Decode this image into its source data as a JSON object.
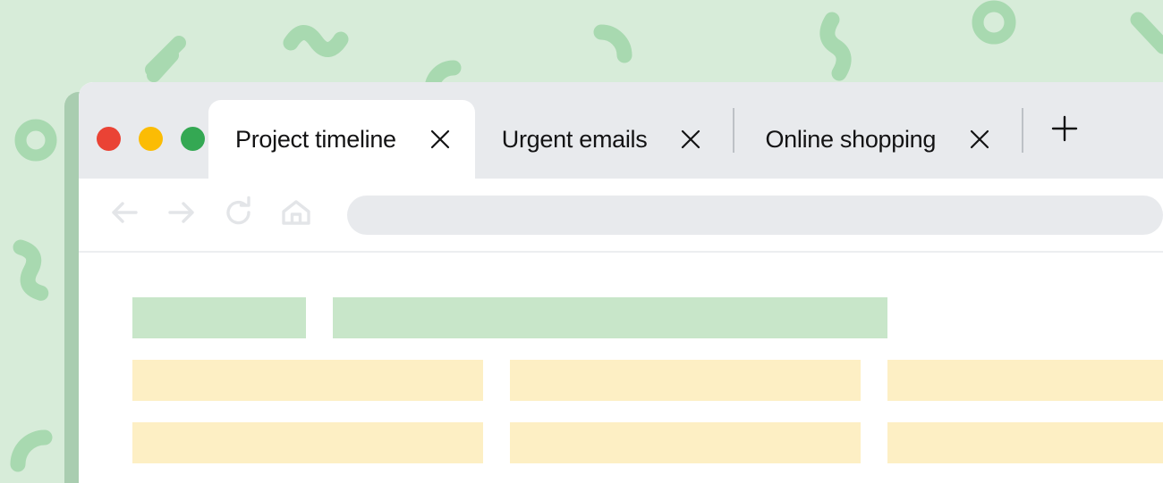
{
  "theme": {
    "backdrop_color": "#d7ecd9",
    "confetti_color": "#a8d9b0",
    "window_shadow_color": "#a9cdb0",
    "tab_strip_color": "#e8eaed",
    "active_tab_color": "#ffffff",
    "toolbar_color": "#ffffff",
    "address_bar_color": "#e8eaed",
    "icon_color": "#e3e5e8",
    "separator_color": "#bdc1c6",
    "block_green": "#c8e6c9",
    "block_yellow": "#fdefc4"
  },
  "window": {
    "traffic_lights": [
      {
        "name": "close-window-button",
        "label": "Close",
        "color": "#ea4335"
      },
      {
        "name": "minimize-window-button",
        "label": "Minimize",
        "color": "#fbbc04"
      },
      {
        "name": "maximize-window-button",
        "label": "Maximize",
        "color": "#34a853"
      }
    ]
  },
  "tabs": [
    {
      "label": "Project timeline",
      "active": true,
      "close_icon": "close-icon"
    },
    {
      "label": "Urgent emails",
      "active": false,
      "close_icon": "close-icon"
    },
    {
      "label": "Online shopping",
      "active": false,
      "close_icon": "close-icon"
    }
  ],
  "new_tab": {
    "label": "+",
    "icon": "plus-icon"
  },
  "toolbar": {
    "buttons": [
      {
        "name": "back-button",
        "icon": "arrow-left-icon",
        "label": "Back"
      },
      {
        "name": "forward-button",
        "icon": "arrow-right-icon",
        "label": "Forward"
      },
      {
        "name": "reload-button",
        "icon": "reload-icon",
        "label": "Reload"
      },
      {
        "name": "home-button",
        "icon": "home-icon",
        "label": "Home"
      }
    ],
    "address_bar": {
      "value": "",
      "placeholder": ""
    }
  },
  "page_content": {
    "rows": [
      {
        "name": "header-row",
        "blocks": [
          {
            "color": "green",
            "width": "w-sm"
          },
          {
            "color": "green",
            "width": "w-lg"
          }
        ]
      },
      {
        "name": "content-row-1",
        "blocks": [
          {
            "color": "yellow",
            "width": "w-md"
          },
          {
            "color": "yellow",
            "width": "w-md"
          },
          {
            "color": "yellow",
            "width": "w-md"
          }
        ]
      },
      {
        "name": "content-row-2",
        "blocks": [
          {
            "color": "yellow",
            "width": "w-md"
          },
          {
            "color": "yellow",
            "width": "w-md"
          },
          {
            "color": "yellow",
            "width": "w-md"
          }
        ]
      }
    ]
  }
}
